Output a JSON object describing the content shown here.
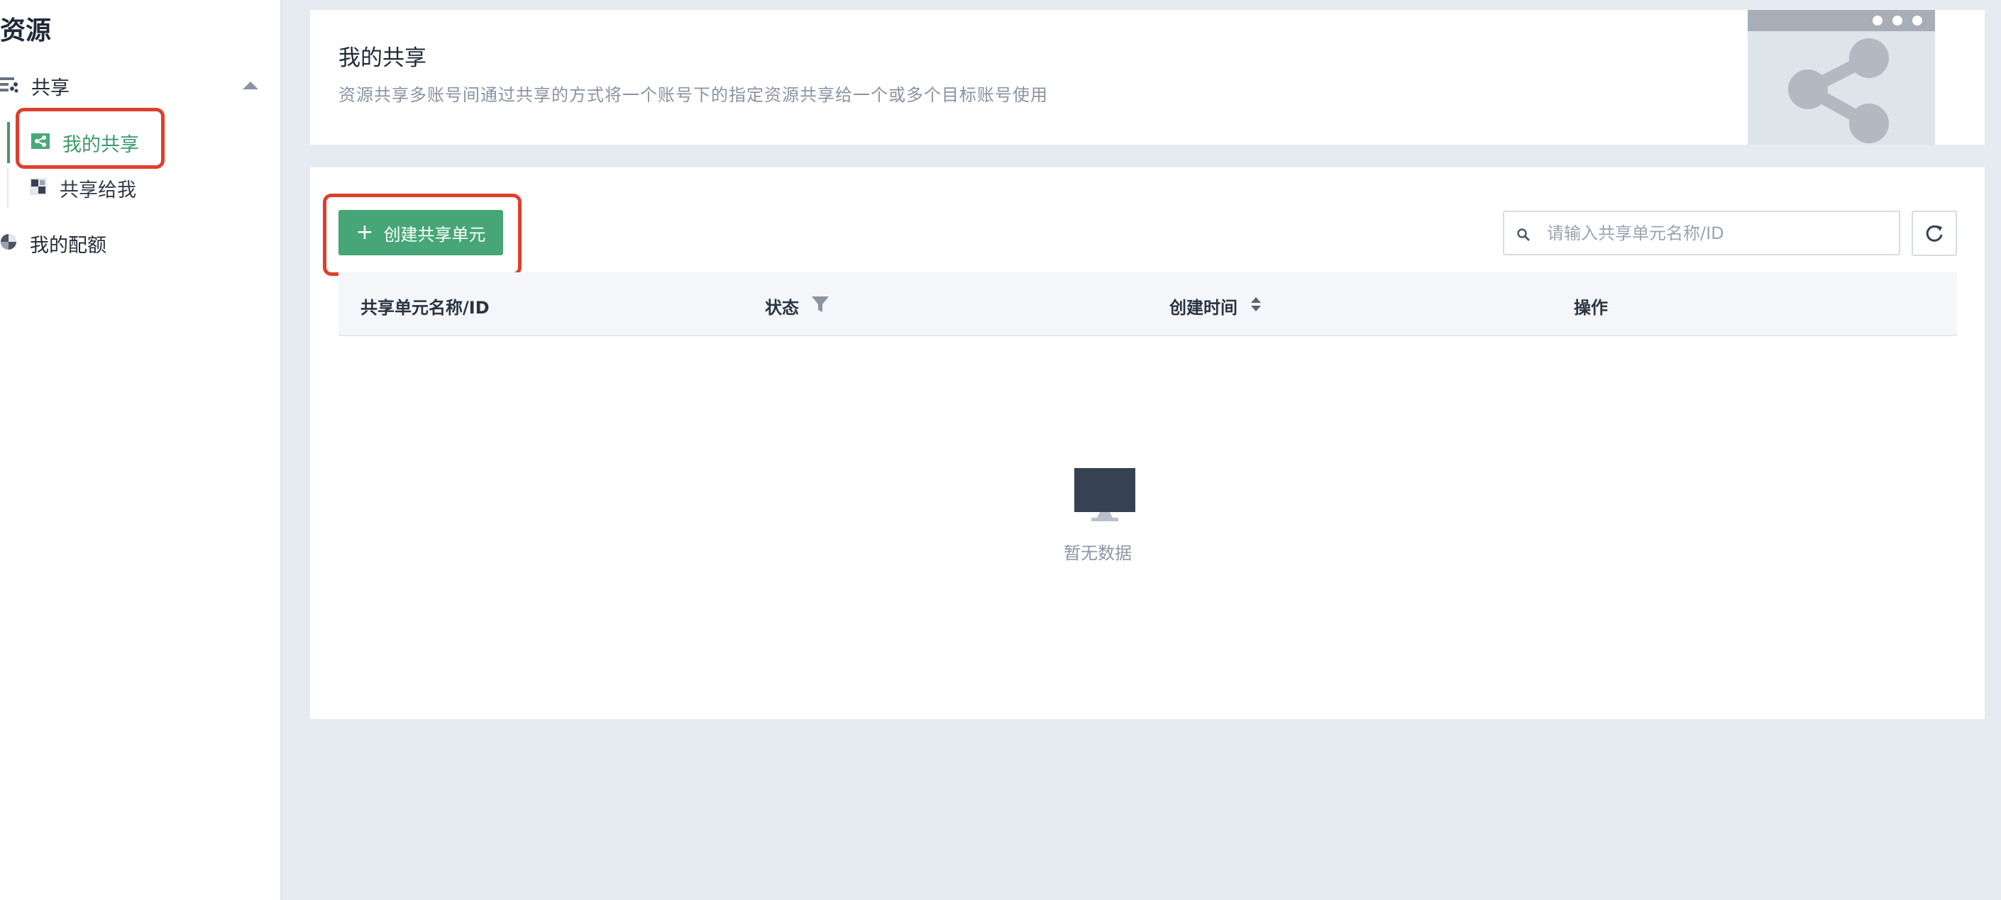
{
  "sidebar": {
    "title": "资源",
    "group_label": "共享",
    "items": [
      {
        "label": "我的共享",
        "active": true
      },
      {
        "label": "共享给我",
        "active": false
      }
    ],
    "quota_label": "我的配额"
  },
  "header": {
    "title": "我的共享",
    "description": "资源共享多账号间通过共享的方式将一个账号下的指定资源共享给一个或多个目标账号使用"
  },
  "toolbar": {
    "create_label": "创建共享单元",
    "search_placeholder": "请输入共享单元名称/ID"
  },
  "table": {
    "columns": [
      "共享单元名称/ID",
      "状态",
      "创建时间",
      "操作"
    ],
    "rows": [],
    "empty_text": "暂无数据"
  },
  "colors": {
    "accent": "#46a677",
    "highlight": "#e03e2d"
  },
  "icons": {
    "group": "share-list-icon",
    "search": "search-icon",
    "refresh": "refresh-icon",
    "filter": "filter-icon",
    "sort": "sort-icon",
    "empty": "monitor-icon"
  }
}
